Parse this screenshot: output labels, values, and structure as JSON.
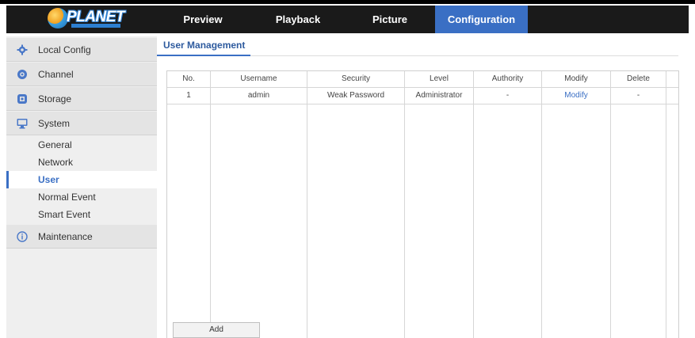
{
  "app": {
    "logo_text": "PLANET",
    "logo_tagline": "Networking & Communication"
  },
  "nav": {
    "tabs": [
      {
        "label": "Preview",
        "active": false
      },
      {
        "label": "Playback",
        "active": false
      },
      {
        "label": "Picture",
        "active": false
      },
      {
        "label": "Configuration",
        "active": true
      }
    ]
  },
  "sidebar": {
    "items": [
      {
        "label": "Local Config",
        "icon": "gear-icon"
      },
      {
        "label": "Channel",
        "icon": "camera-icon"
      },
      {
        "label": "Storage",
        "icon": "storage-icon"
      },
      {
        "label": "System",
        "icon": "monitor-icon",
        "expanded": true
      },
      {
        "label": "Maintenance",
        "icon": "info-icon"
      }
    ],
    "system_subitems": [
      {
        "label": "General",
        "active": false
      },
      {
        "label": "Network",
        "active": false
      },
      {
        "label": "User",
        "active": true
      },
      {
        "label": "Normal Event",
        "active": false
      },
      {
        "label": "Smart Event",
        "active": false
      }
    ]
  },
  "main": {
    "section_title": "User Management",
    "table": {
      "headers": [
        "No.",
        "Username",
        "Security",
        "Level",
        "Authority",
        "Modify",
        "Delete"
      ],
      "rows": [
        {
          "no": "1",
          "username": "admin",
          "security": "Weak Password",
          "level": "Administrator",
          "authority": "-",
          "modify": "Modify",
          "delete": "-"
        }
      ]
    },
    "add_button": "Add"
  },
  "colors": {
    "accent": "#3a6fc4",
    "nav_background": "#1a1a1a",
    "sidebar_background": "#efefef"
  }
}
